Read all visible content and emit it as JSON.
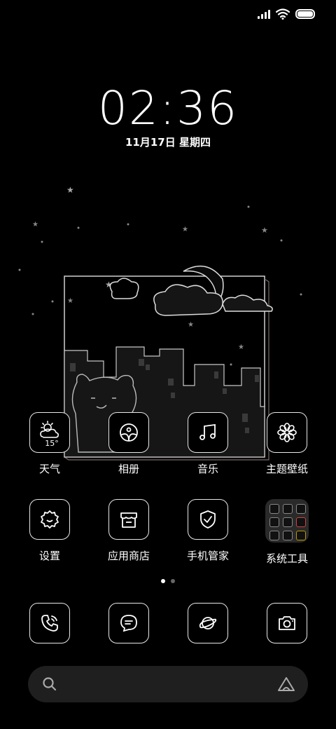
{
  "status_bar": {
    "icons": [
      "signal-icon",
      "wifi-icon",
      "battery-icon"
    ],
    "battery_level": 1.0
  },
  "lockscreen": {
    "time": "02:36",
    "date": "11月17日 星期四"
  },
  "apps_row1": [
    {
      "label": "天气",
      "icon": "weather-icon",
      "temp": "15°"
    },
    {
      "label": "相册",
      "icon": "gallery-icon"
    },
    {
      "label": "音乐",
      "icon": "music-icon"
    },
    {
      "label": "主题壁纸",
      "icon": "theme-icon"
    }
  ],
  "apps_row2": [
    {
      "label": "设置",
      "icon": "settings-icon"
    },
    {
      "label": "应用商店",
      "icon": "store-icon"
    },
    {
      "label": "手机管家",
      "icon": "security-icon"
    },
    {
      "label": "系统工具",
      "icon": "folder-icon"
    }
  ],
  "pager": {
    "count": 2,
    "active": 0
  },
  "dock": [
    {
      "icon": "phone-icon"
    },
    {
      "icon": "messages-icon"
    },
    {
      "icon": "browser-icon"
    },
    {
      "icon": "camera-icon"
    }
  ],
  "search": {
    "icon": "search-icon",
    "assistant_icon": "assistant-icon"
  },
  "colors": {
    "background": "#000000",
    "icon_stroke": "#e8e8e8",
    "search_bg": "#1f1f1f",
    "folder_bg": "#2a2a2a"
  }
}
